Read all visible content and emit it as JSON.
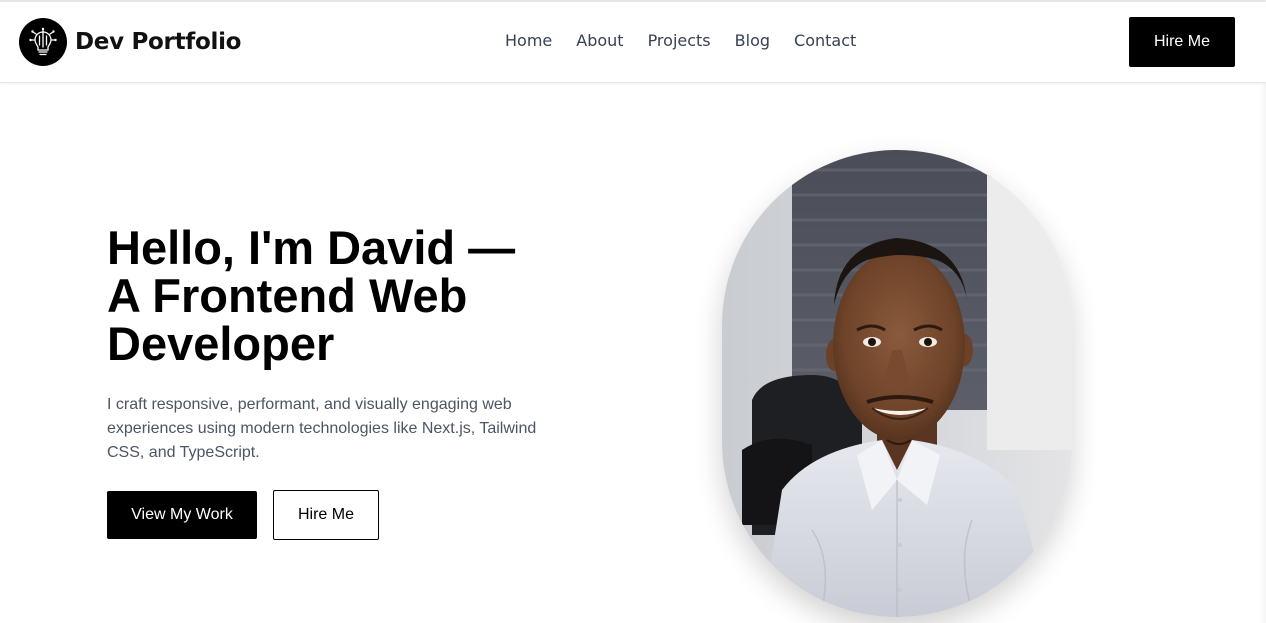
{
  "brand": {
    "name": "Dev Portfolio",
    "logo_icon": "lightbulb-circuit-icon"
  },
  "nav": {
    "items": [
      {
        "label": "Home"
      },
      {
        "label": "About"
      },
      {
        "label": "Projects"
      },
      {
        "label": "Blog"
      },
      {
        "label": "Contact"
      }
    ]
  },
  "header": {
    "hire_label": "Hire Me"
  },
  "hero": {
    "title_line1": "Hello, I'm David —",
    "title_line2": "A Frontend Web",
    "title_line3": "Developer",
    "description": "I craft responsive, performant, and visually engaging web experiences using modern technologies like Next.js, Tailwind CSS, and TypeScript.",
    "primary_cta": "View My Work",
    "secondary_cta": "Hire Me"
  },
  "colors": {
    "primary": "#000000",
    "background": "#ffffff",
    "nav_text": "#374151",
    "body_text": "#4b5563"
  }
}
